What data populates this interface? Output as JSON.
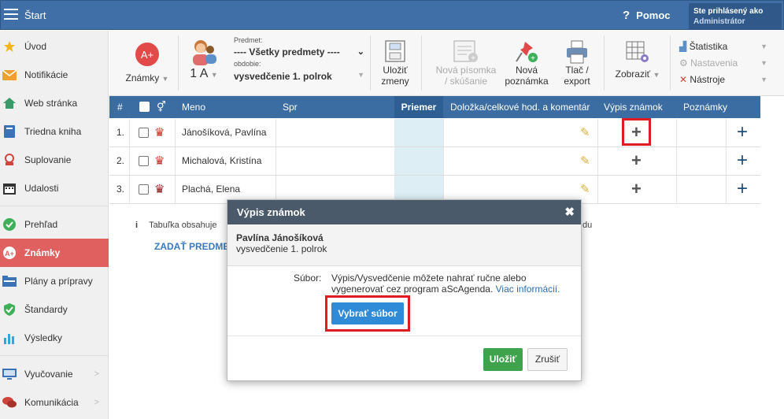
{
  "app": {
    "title": "Štart",
    "help_label": "Pomoc",
    "user_line1": "Ste prihlásený ako",
    "user_line2": "Administrátor"
  },
  "sidebar": {
    "items": [
      {
        "label": "Úvod",
        "icon": "star-icon"
      },
      {
        "label": "Notifikácie",
        "icon": "envelope-icon"
      },
      {
        "label": "Web stránka",
        "icon": "house-icon"
      },
      {
        "label": "Triedna kniha",
        "icon": "book-icon"
      },
      {
        "label": "Suplovanie",
        "icon": "substitution-icon"
      },
      {
        "label": "Udalosti",
        "icon": "calendar-icon"
      },
      {
        "label": "Prehľad",
        "icon": "check-circle-icon"
      },
      {
        "label": "Známky",
        "icon": "grade-icon"
      },
      {
        "label": "Plány a prípravy",
        "icon": "folder-icon"
      },
      {
        "label": "Štandardy",
        "icon": "shield-check-icon"
      },
      {
        "label": "Výsledky",
        "icon": "bar-chart-icon"
      },
      {
        "label": "Vyučovanie",
        "icon": "monitor-icon"
      },
      {
        "label": "Komunikácia",
        "icon": "chat-icon"
      }
    ]
  },
  "toolbar": {
    "grades_label": "Známky",
    "class_label": "1 A",
    "subject_caption": "Predmet:",
    "subject_value": "---- Všetky predmety ----",
    "period_caption": "obdobie:",
    "period_value": "vysvedčenie 1. polrok",
    "save_label_1": "Uložiť",
    "save_label_2": "zmeny",
    "new_test_1": "Nová písomka",
    "new_test_2": "/ skúšanie",
    "new_note_1": "Nová",
    "new_note_2": "poznámka",
    "print_1": "Tlač /",
    "print_2": "export",
    "view_label": "Zobraziť",
    "stats_label": "Štatistika",
    "settings_label": "Nastavenia",
    "tools_label": "Nástroje"
  },
  "table": {
    "headers": {
      "num": "#",
      "name": "Meno",
      "spr": "Spr",
      "avg": "Priemer",
      "clause": "Doložka/celkové hod. a komentár",
      "report": "Výpis známok",
      "notes": "Poznámky"
    },
    "rows": [
      {
        "num": "1.",
        "name": "Jánošíková, Pavlína"
      },
      {
        "num": "2.",
        "name": "Michalová, Kristína"
      },
      {
        "num": "3.",
        "name": "Plachá, Elena"
      }
    ]
  },
  "info": {
    "text": "Tabuľka obsahuje",
    "text_end": "du",
    "link": "ZADAŤ PREDME"
  },
  "modal": {
    "title": "Výpis známok",
    "student": "Pavlína Jánošíková",
    "period": "vysvedčenie 1. polrok",
    "file_label": "Súbor:",
    "file_text": "Výpis/Vysvedčenie môžete nahrať ručne alebo vygenerovať cez program aScAgenda.",
    "more_link": "Viac informácií.",
    "choose_btn": "Vybrať súbor",
    "save_btn": "Uložiť",
    "cancel_btn": "Zrušiť"
  },
  "colors": {
    "topbar": "#3f6fa6",
    "active": "#e06060",
    "save": "#3fa34d",
    "file_btn": "#2f8ad8",
    "highlight": "#e01b24"
  }
}
